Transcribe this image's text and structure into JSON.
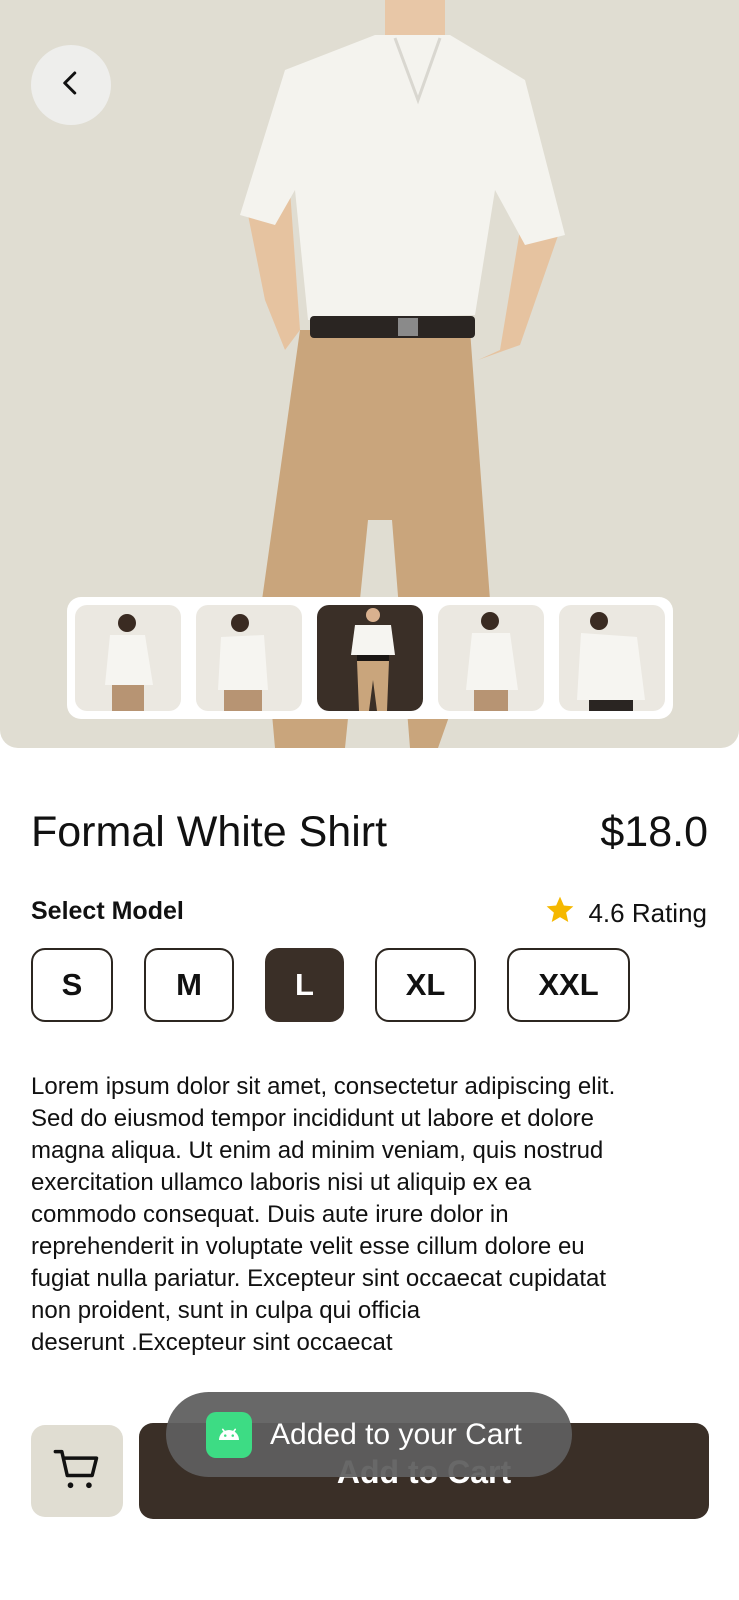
{
  "product": {
    "title": "Formal White Shirt",
    "price": "$18.0",
    "select_model_label": "Select Model",
    "rating": "4.6 Rating",
    "sizes": [
      "S",
      "M",
      "L",
      "XL",
      "XXL"
    ],
    "selected_size": "L",
    "description": "Lorem ipsum dolor sit amet, consectetur adipiscing elit.\nSed  do eiusmod tempor incididunt ut labore et dolore\nmagna  aliqua. Ut enim ad minim veniam, quis nostrud\nexercitation  ullamco laboris nisi ut aliquip ex ea\ncommodo consequat.  Duis aute irure dolor in\nreprehenderit in voluptate velit esse  cillum dolore eu\nfugiat nulla pariatur. Excepteur sint occaecat  cupidatat\nnon proident, sunt in culpa qui officia\ndeserunt .Excepteur sint occaecat"
  },
  "gallery": {
    "thumbnail_count": 5,
    "active_index": 2
  },
  "actions": {
    "add_to_cart_label": "Add to Cart"
  },
  "toast": {
    "text": "Added to your Cart"
  },
  "icons": {
    "back": "chevron-left-icon",
    "star": "star-icon",
    "cart": "cart-icon",
    "toast_app": "android-app-icon"
  },
  "colors": {
    "hero_bg": "#e0ddd2",
    "accent_dark": "#3a2f27",
    "star": "#f5b800",
    "toast_icon": "#3ddc84"
  }
}
